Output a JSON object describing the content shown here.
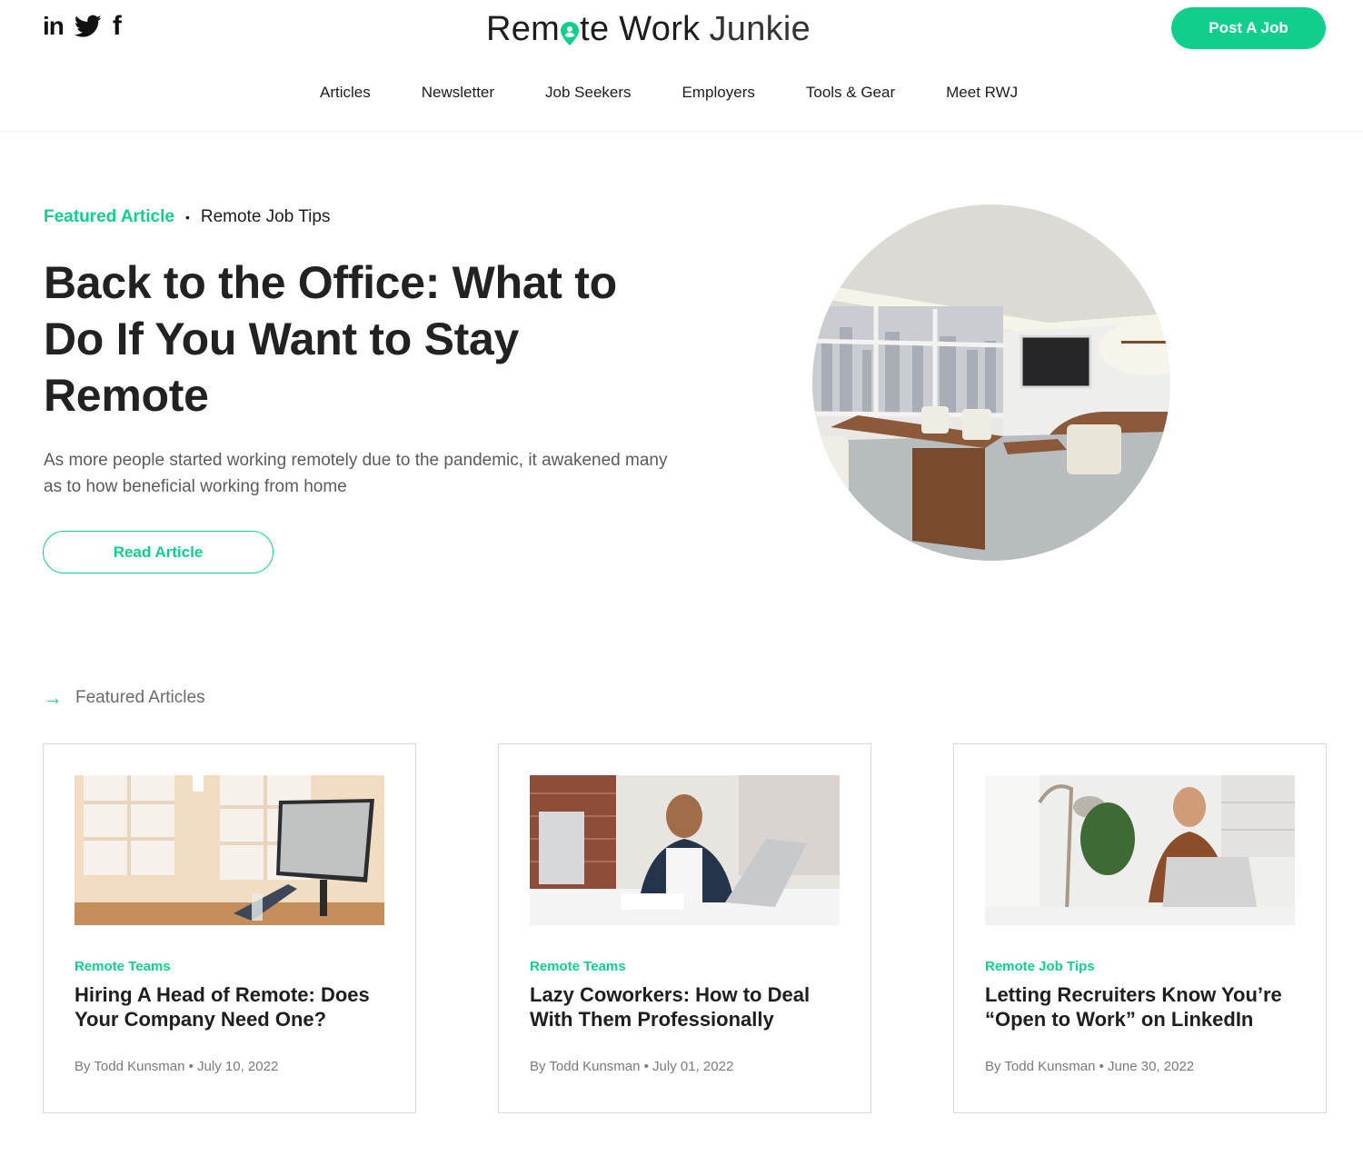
{
  "header": {
    "social": [
      {
        "name": "linkedin-icon",
        "glyph": "in"
      },
      {
        "name": "twitter-icon",
        "glyph": ""
      },
      {
        "name": "facebook-icon",
        "glyph": "f"
      }
    ],
    "logo": {
      "part1": "Rem",
      "part2": "te Work",
      "part3": "Junkie"
    },
    "post_job_label": "Post A Job",
    "nav": [
      "Articles",
      "Newsletter",
      "Job Seekers",
      "Employers",
      "Tools & Gear",
      "Meet RWJ"
    ]
  },
  "hero": {
    "badge": "Featured Article",
    "separator": "•",
    "category": "Remote Job Tips",
    "title": "Back to the Office: What to Do If You Want to Stay Remote",
    "description": "As more people started working remotely due to the pandemic, it awakened many as to how beneficial working from home",
    "button_label": "Read Article"
  },
  "section": {
    "arrow": "→",
    "title": "Featured Articles"
  },
  "cards": [
    {
      "category": "Remote Teams",
      "title": "Hiring A Head of Remote: Does Your Company Need One?",
      "byline": "By Todd Kunsman • July 10, 2022"
    },
    {
      "category": "Remote Teams",
      "title": "Lazy Coworkers: How to Deal With Them Professionally",
      "byline": "By Todd Kunsman • July 01, 2022"
    },
    {
      "category": "Remote Job Tips",
      "title": "Letting Recruiters Know You’re “Open to Work” on LinkedIn",
      "byline": "By Todd Kunsman • June 30, 2022"
    }
  ],
  "colors": {
    "accent": "#10cf8d",
    "text": "#1e1e1e",
    "muted": "#7a7a7a"
  }
}
